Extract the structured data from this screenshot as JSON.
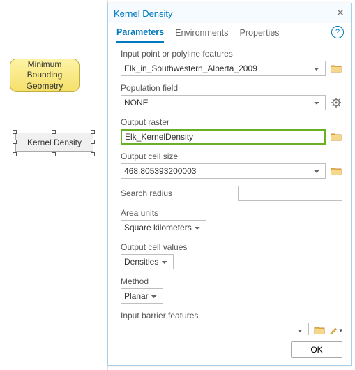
{
  "canvas": {
    "mbg_label": "Minimum\nBounding\nGeometry",
    "kd_label": "Kernel Density"
  },
  "dialog": {
    "title": "Kernel Density",
    "tabs": {
      "parameters": "Parameters",
      "environments": "Environments",
      "properties": "Properties"
    },
    "fields": {
      "input_label": "Input point or polyline features",
      "input_value": "Elk_in_Southwestern_Alberta_2009",
      "pop_label": "Population field",
      "pop_value": "NONE",
      "outraster_label": "Output raster",
      "outraster_value": "Elk_KernelDensity",
      "cellsize_label": "Output cell size",
      "cellsize_value": "468.805393200003",
      "radius_label": "Search radius",
      "radius_value": "",
      "units_label": "Area units",
      "units_value": "Square kilometers",
      "cellvals_label": "Output cell values",
      "cellvals_value": "Densities",
      "method_label": "Method",
      "method_value": "Planar",
      "barrier_label": "Input barrier features",
      "barrier_value": ""
    },
    "ok": "OK"
  }
}
